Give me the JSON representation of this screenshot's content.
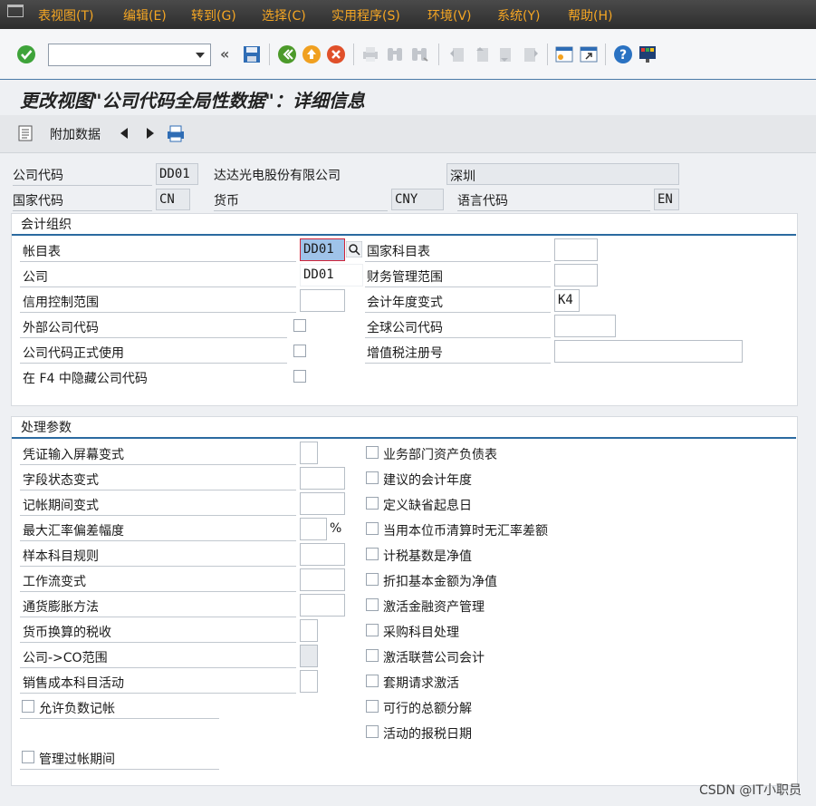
{
  "menu": {
    "items": [
      "表视图(T)",
      "编辑(E)",
      "转到(G)",
      "选择(C)",
      "实用程序(S)",
      "环境(V)",
      "系统(Y)",
      "帮助(H)"
    ]
  },
  "toolbar": {
    "command_value": "",
    "icons": [
      "enter-icon",
      "save-icon",
      "back-icon",
      "exit-icon",
      "cancel-icon",
      "print-icon",
      "find-icon",
      "find-next-icon",
      "first-page-icon",
      "prev-page-icon",
      "next-page-icon",
      "last-page-icon",
      "new-session-icon",
      "shortcut-icon",
      "help-icon",
      "customize-layout-icon"
    ]
  },
  "title": "更改视图\"公司代码全局性数据\"：详细信息",
  "app_toolbar": {
    "additional_data_label": "附加数据"
  },
  "header": {
    "company_code_label": "公司代码",
    "company_code_value": "DD01",
    "company_name": "达达光电股份有限公司",
    "city": "深圳",
    "country_label": "国家代码",
    "country_value": "CN",
    "currency_label": "货币",
    "currency_value": "CNY",
    "language_label": "语言代码",
    "language_value": "EN"
  },
  "accounting_org": {
    "title": "会计组织",
    "chart_of_accounts_label": "帐目表",
    "chart_of_accounts_value": "DD01",
    "country_coa_label": "国家科目表",
    "country_coa_value": "",
    "company_label": "公司",
    "company_value": "DD01",
    "fm_area_label": "财务管理范围",
    "fm_area_value": "",
    "credit_control_label": "信用控制范围",
    "credit_control_value": "",
    "fiscal_year_variant_label": "会计年度变式",
    "fiscal_year_variant_value": "K4",
    "external_cc_label": "外部公司代码",
    "global_cc_label": "全球公司代码",
    "global_cc_value": "",
    "cc_productive_label": "公司代码正式使用",
    "vat_reg_label": "增值税注册号",
    "vat_reg_value": "",
    "hide_f4_label": "在 F4 中隐藏公司代码"
  },
  "processing": {
    "title": "处理参数",
    "left_fields": [
      {
        "label": "凭证输入屏幕变式",
        "value": ""
      },
      {
        "label": "字段状态变式",
        "value": ""
      },
      {
        "label": "记帐期间变式",
        "value": ""
      },
      {
        "label": "最大汇率偏差幅度",
        "value": "",
        "unit": "%"
      },
      {
        "label": "样本科目规则",
        "value": ""
      },
      {
        "label": "工作流变式",
        "value": ""
      },
      {
        "label": "通货膨胀方法",
        "value": ""
      },
      {
        "label": "货币换算的税收",
        "value": ""
      },
      {
        "label": "公司->CO范围",
        "value": ""
      },
      {
        "label": "销售成本科目活动",
        "value": ""
      }
    ],
    "allow_negative_label": "允许负数记帐",
    "manage_periods_label": "管理过帐期间",
    "right_checkboxes": [
      "业务部门资产负债表",
      "建议的会计年度",
      "定义缺省起息日",
      "当用本位币清算时无汇率差额",
      "计税基数是净值",
      "折扣基本金额为净值",
      "激活金融资产管理",
      "采购科目处理",
      "激活联营公司会计",
      "套期请求激活",
      "可行的总额分解",
      "活动的报税日期"
    ]
  },
  "watermark": "CSDN @IT小职员"
}
